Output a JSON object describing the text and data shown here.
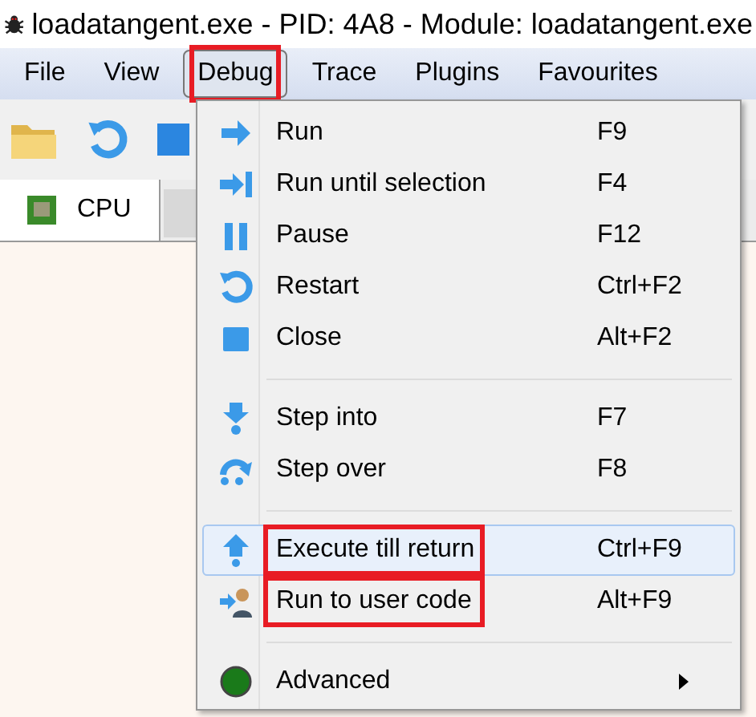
{
  "window": {
    "title": "loadatangent.exe - PID: 4A8 - Module: loadatangent.exe"
  },
  "menubar": [
    {
      "label": "File",
      "open": false,
      "annotated": false
    },
    {
      "label": "View",
      "open": false,
      "annotated": false
    },
    {
      "label": "Debug",
      "open": true,
      "annotated": true
    },
    {
      "label": "Trace",
      "open": false,
      "annotated": false
    },
    {
      "label": "Plugins",
      "open": false,
      "annotated": false
    },
    {
      "label": "Favourites",
      "open": false,
      "annotated": false
    }
  ],
  "tabs": [
    {
      "label": "CPU",
      "selected": true
    }
  ],
  "debug_menu": [
    {
      "kind": "item",
      "label": "Run",
      "shortcut": "F9",
      "highlighted": false,
      "annotated": false
    },
    {
      "kind": "item",
      "label": "Run until selection",
      "shortcut": "F4",
      "highlighted": false,
      "annotated": false
    },
    {
      "kind": "item",
      "label": "Pause",
      "shortcut": "F12",
      "highlighted": false,
      "annotated": false
    },
    {
      "kind": "item",
      "label": "Restart",
      "shortcut": "Ctrl+F2",
      "highlighted": false,
      "annotated": false
    },
    {
      "kind": "item",
      "label": "Close",
      "shortcut": "Alt+F2",
      "highlighted": false,
      "annotated": false
    },
    {
      "kind": "separator"
    },
    {
      "kind": "item",
      "label": "Step into",
      "shortcut": "F7",
      "highlighted": false,
      "annotated": false
    },
    {
      "kind": "item",
      "label": "Step over",
      "shortcut": "F8",
      "highlighted": false,
      "annotated": false
    },
    {
      "kind": "separator"
    },
    {
      "kind": "item",
      "label": "Execute till return",
      "shortcut": "Ctrl+F9",
      "highlighted": true,
      "annotated": true
    },
    {
      "kind": "item",
      "label": "Run to user code",
      "shortcut": "Alt+F9",
      "highlighted": false,
      "annotated": true
    },
    {
      "kind": "separator"
    },
    {
      "kind": "submenu",
      "label": "Advanced",
      "highlighted": false,
      "annotated": false
    }
  ]
}
